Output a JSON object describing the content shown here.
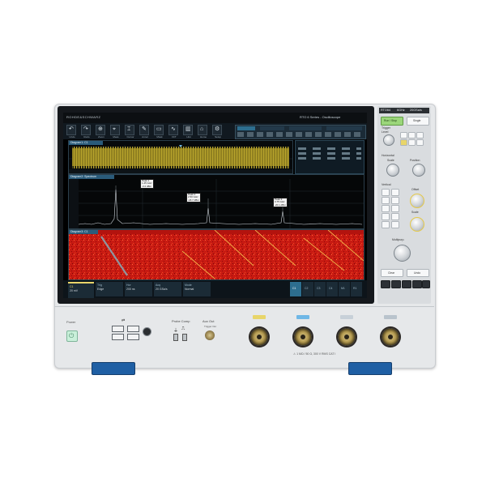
{
  "brand": {
    "name": "ROHDE&SCHWARZ"
  },
  "model_strip": {
    "model": "RTO64",
    "bandwidth": "6GHz",
    "sample_rate": "20GSa/s"
  },
  "screen": {
    "app_title": "RTO 6 Series - Oscilloscope",
    "toolbar": [
      {
        "label": "Undo",
        "icon": "undo-icon"
      },
      {
        "label": "Redo",
        "icon": "redo-icon"
      },
      {
        "label": "Zoom",
        "icon": "zoom-icon"
      },
      {
        "label": "Meas",
        "icon": "measure-icon"
      },
      {
        "label": "Cursor",
        "icon": "cursor-icon"
      },
      {
        "label": "Annot",
        "icon": "pen-icon"
      },
      {
        "label": "Mask",
        "icon": "mask-icon"
      },
      {
        "label": "FFT",
        "icon": "fft-icon"
      },
      {
        "label": "Hist",
        "icon": "histogram-icon"
      },
      {
        "label": "Home",
        "icon": "home-icon"
      },
      {
        "label": "Setup",
        "icon": "gear-icon"
      }
    ],
    "diagram1_title": "Diagram1: C1",
    "diagram2_title": "Diagram2: Spectrum",
    "diagram3_title": "Diagram3: C1",
    "spectrum_markers": [
      {
        "lines": [
          "Peak 1",
          "1.25 GHz",
          "-3.2 dBm"
        ]
      },
      {
        "lines": [
          "Peak 2",
          "2.50 GHz",
          "-18.7 dBm"
        ]
      },
      {
        "lines": [
          "Peak 3",
          "3.75 GHz",
          "-20.1 dBm"
        ]
      }
    ],
    "status_bar": [
      {
        "label": "C1",
        "value": "20 mV"
      },
      {
        "label": "Trig",
        "value": "Edge"
      },
      {
        "label": "Hor",
        "value": "200 ns"
      },
      {
        "label": "Acq",
        "value": "20 GSa/s"
      },
      {
        "label": "Mode",
        "value": "Normal"
      }
    ],
    "channel_tabs": [
      "C1",
      "C2",
      "C3",
      "C4",
      "M1",
      "R1"
    ]
  },
  "front_panel": {
    "power_label": "Power",
    "probe_comp_label": "Probe Comp",
    "aux_out_label": "Aux Out",
    "aux_sub_label": "Trigger Out",
    "channel_colors": [
      "#e8d56a",
      "#6fb7e6",
      "#c7d0d8",
      "#b9c3cc"
    ],
    "warning_text": "⚠ 1 MΩ / 50 Ω, 300 V RMS CAT I"
  },
  "right_panel": {
    "run_stop_label": "Run / Stop",
    "single_label": "Single",
    "trigger_label": "Trigger",
    "level_label": "Level",
    "horizontal_label": "Horizontal",
    "scale_label": "Scale",
    "position_label": "Position",
    "vertical_label": "Vertical",
    "offset_label": "Offset",
    "multipurpose_label": "Multipurp.",
    "clear_label": "Clear",
    "undo_label": "Undo"
  },
  "colors": {
    "trace_yellow": "#b8a42c",
    "spectrum_red": "#d21f16",
    "accent_blue": "#2a5b7a",
    "foot_blue": "#1f5fa4"
  }
}
